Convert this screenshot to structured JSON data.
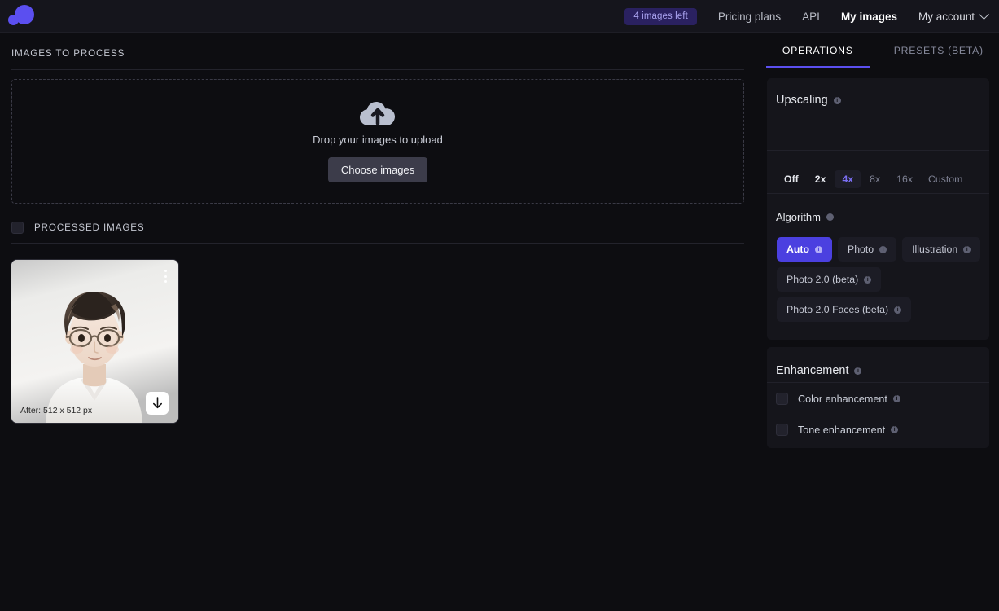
{
  "header": {
    "logo_name": "logo-icon",
    "credits_badge": "4 images left",
    "nav": [
      {
        "label": "Pricing plans",
        "active": false
      },
      {
        "label": "API",
        "active": false
      },
      {
        "label": "My images",
        "active": true
      }
    ],
    "account_label": "My account"
  },
  "main": {
    "images_to_process_label": "IMAGES TO PROCESS",
    "dropzone": {
      "icon": "cloud-upload-icon",
      "text": "Drop your images to upload",
      "button_label": "Choose images"
    },
    "processed_images_label": "PROCESSED IMAGES",
    "card": {
      "size_label": "After: 512 x 512 px",
      "menu_icon": "kebab-menu-icon",
      "download_icon": "download-icon"
    }
  },
  "right": {
    "tabs": [
      {
        "label": "OPERATIONS",
        "active": true
      },
      {
        "label": "PRESETS (BETA)",
        "active": false
      }
    ],
    "upscaling": {
      "title": "Upscaling",
      "options": [
        {
          "label": "Off",
          "state": "bright"
        },
        {
          "label": "2x",
          "state": "bright"
        },
        {
          "label": "4x",
          "state": "selected"
        },
        {
          "label": "8x",
          "state": "dim"
        },
        {
          "label": "16x",
          "state": "dim"
        },
        {
          "label": "Custom",
          "state": "dim"
        }
      ]
    },
    "algorithm": {
      "title": "Algorithm",
      "options": [
        {
          "label": "Auto",
          "selected": true
        },
        {
          "label": "Photo",
          "selected": false
        },
        {
          "label": "Illustration",
          "selected": false
        },
        {
          "label": "Photo 2.0 (beta)",
          "selected": false
        },
        {
          "label": "Photo 2.0 Faces (beta)",
          "selected": false
        }
      ]
    },
    "enhancement": {
      "title": "Enhancement",
      "options": [
        {
          "label": "Color enhancement",
          "checked": false
        },
        {
          "label": "Tone enhancement",
          "checked": false
        }
      ]
    }
  },
  "colors": {
    "accent": "#5b4ff0",
    "accent_button": "#4b40e0",
    "badge_bg": "#2a2160",
    "panel_bg": "#15151b",
    "page_bg": "#0d0d11"
  }
}
